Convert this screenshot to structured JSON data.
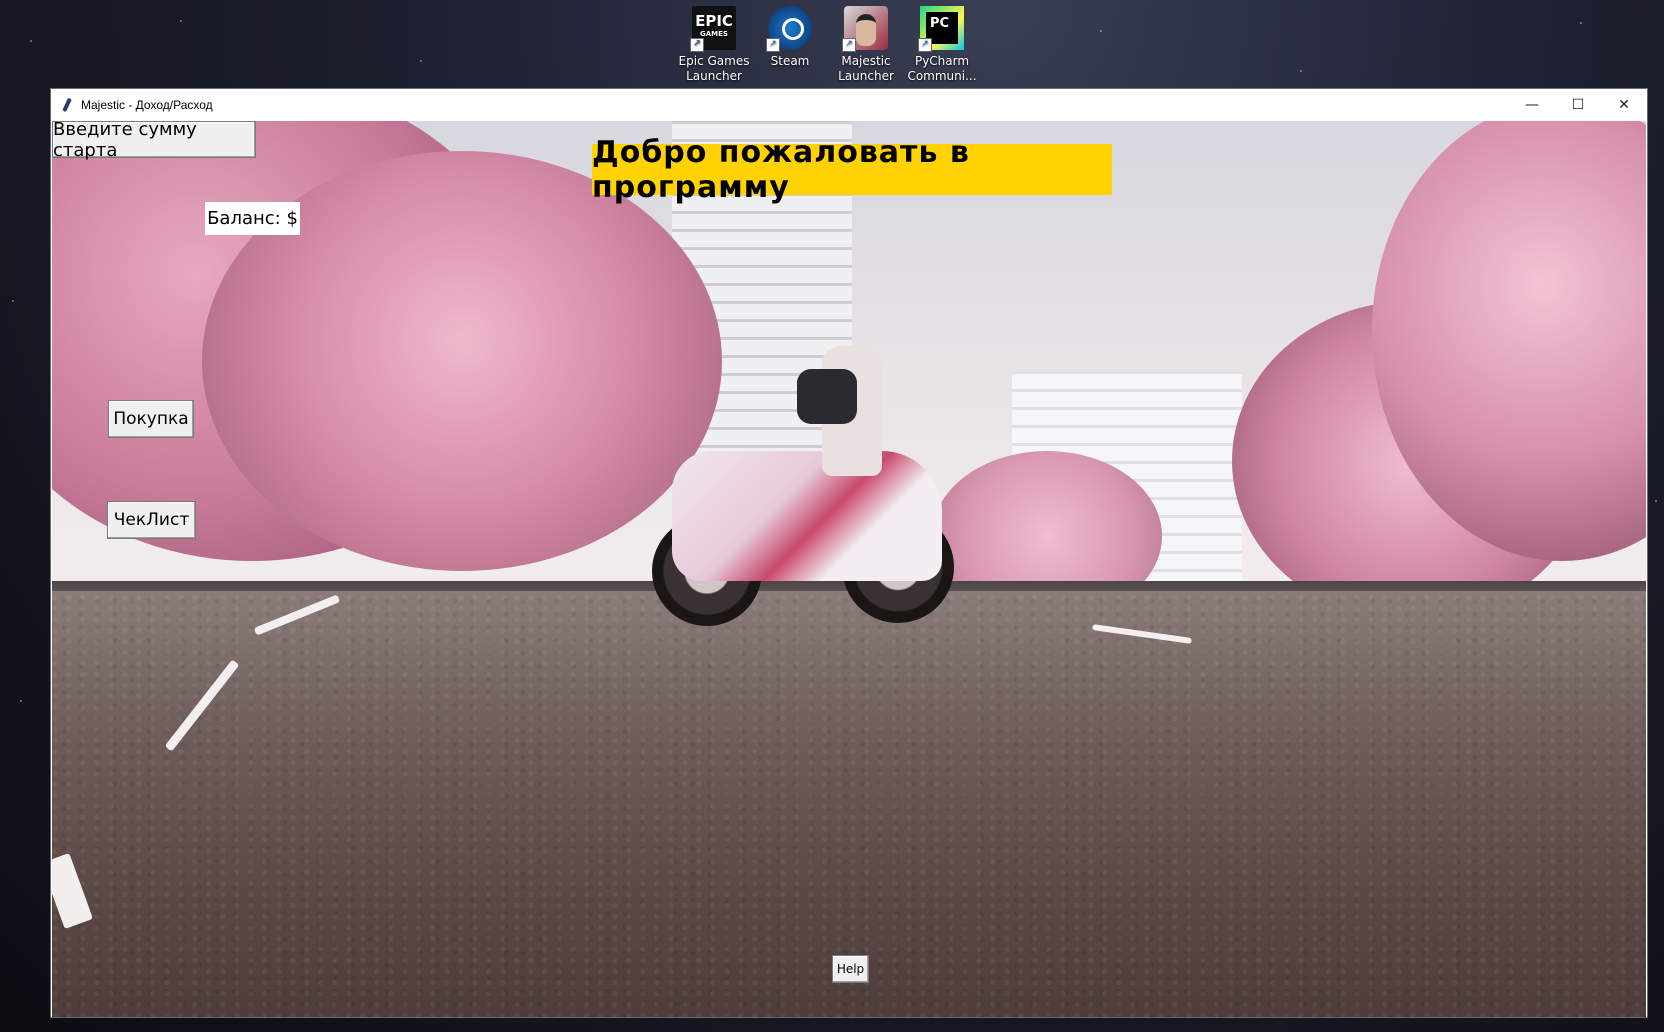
{
  "desktop": {
    "icons": [
      {
        "label_line1": "Epic Games",
        "label_line2": "Launcher",
        "icon": "epic-games-icon"
      },
      {
        "label_line1": "Steam",
        "label_line2": "",
        "icon": "steam-icon"
      },
      {
        "label_line1": "Majestic",
        "label_line2": "Launcher",
        "icon": "majestic-launcher-icon"
      },
      {
        "label_line1": "PyCharm",
        "label_line2": "Communi...",
        "icon": "pycharm-icon"
      }
    ],
    "epic_logo_text": "EPIC",
    "epic_logo_sub": "GAMES",
    "pycharm_logo_text": "PC"
  },
  "window": {
    "title": "Majestic - Доход/Расход",
    "controls": {
      "minimize": "—",
      "maximize": "☐",
      "close": "✕"
    }
  },
  "app": {
    "start_sum_button": "Введите сумму старта",
    "welcome_label": "Добро пожаловать в программу",
    "balance_label": "Баланс: $",
    "purchase_button": "Покупка",
    "checklist_button": "ЧекЛист",
    "help_button": "Help"
  },
  "colors": {
    "welcome_bg": "#ffd200",
    "button_bg": "#f0f0f0",
    "trees": "#d48aa6"
  }
}
